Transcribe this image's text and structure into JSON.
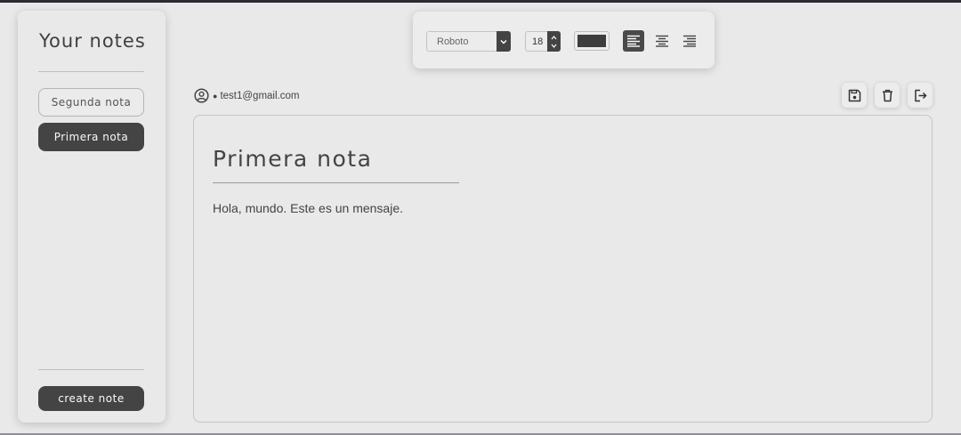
{
  "sidebar": {
    "title": "Your notes",
    "notes": [
      {
        "label": "Segunda nota",
        "selected": false
      },
      {
        "label": "Primera nota",
        "selected": true
      }
    ],
    "create_label": "create note"
  },
  "toolbar": {
    "font_family_value": "Roboto",
    "font_size_value": "18",
    "text_color": "#3d3d3d",
    "alignment_selected": "left",
    "align_icons": [
      "align-left-icon",
      "align-center-icon",
      "align-right-icon"
    ]
  },
  "user": {
    "icon": "user-circle-icon",
    "email": "test1@gmail.com"
  },
  "actions": [
    "save-icon",
    "trash-icon",
    "logout-icon"
  ],
  "note": {
    "title": "Primera nota",
    "body": "Hola, mundo. Este es un mensaje."
  },
  "colors": {
    "accent": "#444444",
    "background": "#e9e9e9"
  }
}
